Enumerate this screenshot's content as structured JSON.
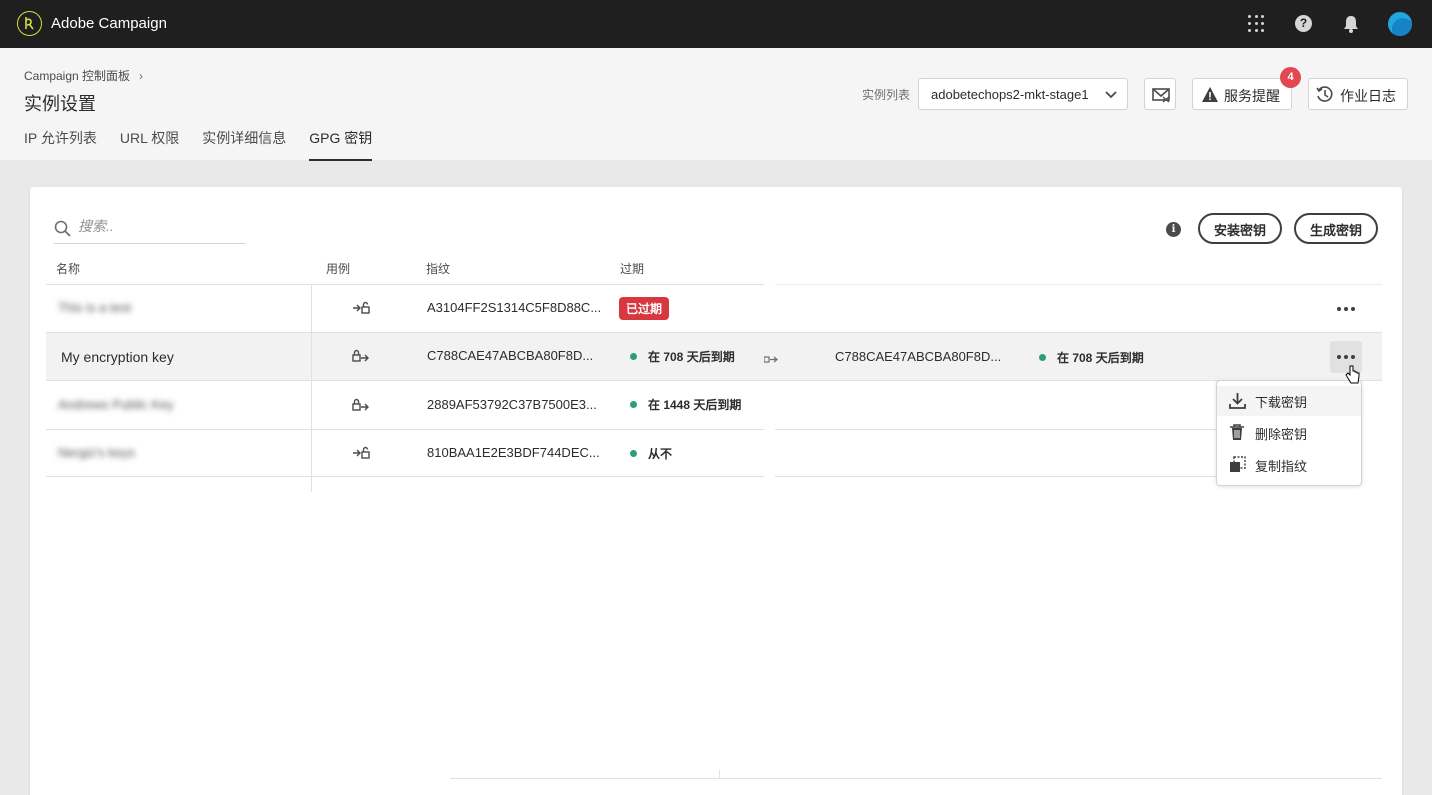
{
  "app": {
    "title": "Adobe Campaign"
  },
  "header": {
    "breadcrumb": "Campaign 控制面板",
    "page_title": "实例设置",
    "instance_label": "实例列表",
    "instance_value": "adobetechops2-mkt-stage1",
    "alerts_label": "服务提醒",
    "alerts_count": "4",
    "joblog_label": "作业日志"
  },
  "tabs": [
    {
      "label": "IP 允许列表"
    },
    {
      "label": "URL 权限"
    },
    {
      "label": "实例详细信息"
    },
    {
      "label": "GPG 密钥",
      "active": true
    }
  ],
  "toolbar": {
    "search_placeholder": "搜索..",
    "install_label": "安装密钥",
    "generate_label": "生成密钥"
  },
  "table": {
    "columns": [
      "名称",
      "用例",
      "指纹",
      "过期"
    ],
    "rows": [
      {
        "name": "This is a test",
        "usecase": "decrypt",
        "fingerprint": "A3104FF2S1314C5F8D88C...",
        "expiry": "已过期",
        "status": "expired"
      },
      {
        "name": "My encryption key",
        "usecase": "encrypt",
        "fingerprint": "C788CAE47ABCBA80F8D...",
        "expiry": "在 708 天后到期",
        "status": "ok"
      },
      {
        "name": "Andrews Public Key",
        "usecase": "encrypt",
        "fingerprint": "2889AF53792C37B7500E3...",
        "expiry": "在 1448 天后到期",
        "status": "ok"
      },
      {
        "name": "Nergiz's keys",
        "usecase": "decrypt",
        "fingerprint": "810BAA1E2E3BDF744DEC...",
        "expiry": "从不",
        "status": "ok"
      }
    ],
    "ghost": {
      "fingerprint": "C788CAE47ABCBA80F8D...",
      "expiry": "在 708 天后到期"
    }
  },
  "menu": {
    "items": [
      {
        "label": "下载密钥",
        "icon": "download-icon"
      },
      {
        "label": "删除密钥",
        "icon": "trash-icon"
      },
      {
        "label": "复制指纹",
        "icon": "copy-icon"
      }
    ]
  },
  "colors": {
    "accent": "#2d9d78",
    "danger": "#d7373f",
    "badge": "#e34850"
  }
}
